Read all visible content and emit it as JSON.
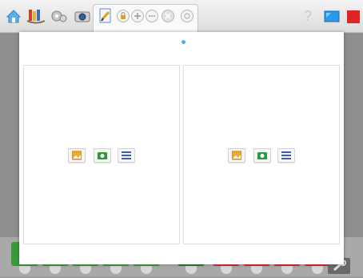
{
  "toolbar": {
    "icons": [
      "home-icon",
      "books-icon",
      "gears-icon",
      "camera-icon",
      "edit-page-icon",
      "lock-icon",
      "add-icon",
      "more-icon",
      "delete-icon",
      "settings-icon",
      "help-icon",
      "blue-screen-icon",
      "red-square-icon"
    ],
    "help_label": "?"
  },
  "dialog": {
    "page_indicator": "page-dot",
    "panels": [
      {
        "name": "left",
        "buttons": [
          "image-icon",
          "camera-icon",
          "text-lines-icon"
        ]
      },
      {
        "name": "right",
        "buttons": [
          "image-icon",
          "camera-icon",
          "text-lines-icon"
        ]
      }
    ]
  },
  "colors": {
    "accent_blue": "#4aaee8",
    "image_orange": "#f0a830",
    "camera_green": "#2e9a3e",
    "text_blue": "#3a5fb8",
    "block_green": "#3a9a3a",
    "block_red": "#d42a2a"
  }
}
